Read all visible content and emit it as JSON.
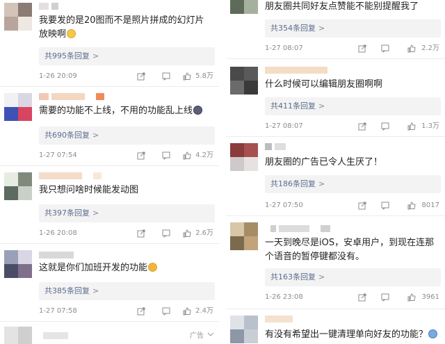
{
  "left": {
    "comments": [
      {
        "text": "我要发的是20图而不是照片拼成的幻灯片放映啊",
        "replies": "共995条回复",
        "time": "1-26 20:09",
        "likes": "5.8万"
      },
      {
        "text": "需要的功能不上线，不用的功能乱上线",
        "replies": "共690条回复",
        "time": "1-27 07:54",
        "likes": "4.2万"
      },
      {
        "text": "我只想问啥时候能发动图",
        "replies": "共397条回复",
        "time": "1-26 20:08",
        "likes": "2.6万"
      },
      {
        "text": "这就是你们加班开发的功能",
        "replies": "共385条回复",
        "time": "1-27 07:58",
        "likes": "2.4万"
      }
    ],
    "ad_label": "广告"
  },
  "right": {
    "comments": [
      {
        "text": "朋友圈共同好友点赞能不能别提醒我了",
        "replies": "共354条回复",
        "time": "1-27 08:07",
        "likes": "2.2万"
      },
      {
        "text": "什么时候可以编辑朋友圈啊啊",
        "replies": "共411条回复",
        "time": "1-27 08:07",
        "likes": "1.3万"
      },
      {
        "text": "朋友圈的广告已令人生厌了！",
        "replies": "共186条回复",
        "time": "1-27 07:50",
        "likes": "8017"
      },
      {
        "text": "一天到晚尽是iOS，安卓用户，到现在连那个语音的暂停键都没有。",
        "replies": "共163条回复",
        "time": "1-26 23:08",
        "likes": "3961"
      },
      {
        "text": "有没有希望出一键清理单向好友的功能？"
      }
    ]
  },
  "icons": {
    "share": "share-icon",
    "comment": "comment-icon",
    "like": "thumbs-up-icon",
    "chevron": "chevron-right-icon"
  },
  "chevron_glyph": ">"
}
